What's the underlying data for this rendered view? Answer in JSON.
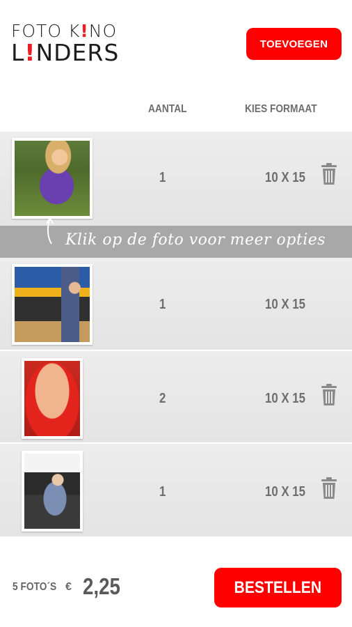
{
  "logo": {
    "line1": "FOTO K!NO",
    "line2": "L!NDERS"
  },
  "header": {
    "add_label": "TOEVOEGEN"
  },
  "columns": {
    "aantal": "AANTAL",
    "formaat": "KIES FORMAAT"
  },
  "hint": {
    "text": "Klik op de foto voor meer opties"
  },
  "rows": [
    {
      "qty": "1",
      "format": "10 X 15",
      "trash": true
    },
    {
      "qty": "1",
      "format": "10 X 15",
      "trash": false
    },
    {
      "qty": "2",
      "format": "10 X 15",
      "trash": true
    },
    {
      "qty": "1",
      "format": "10 X 15",
      "trash": true
    }
  ],
  "footer": {
    "count": "5 FOTO´S",
    "currency": "€",
    "price": "2,25",
    "order_label": "BESTELLEN"
  },
  "colors": {
    "accent": "#ff0000",
    "row_bg": "#ebebeb",
    "hint_bg": "#a8a8a8",
    "text_gray": "#6e6e6e"
  },
  "icons": [
    "trash-icon",
    "curved-arrow-icon"
  ]
}
